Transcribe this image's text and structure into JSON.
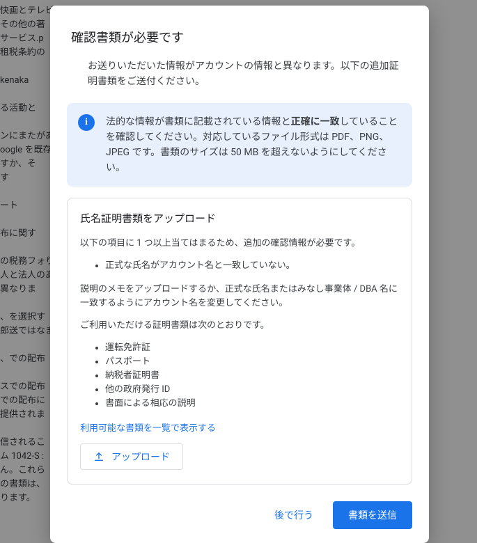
{
  "background_lines": [
    "快画とテレビ番組 pdf",
    "その他の著",
    "サービス.p",
    "租税条約の",
    "",
    "kenaka",
    "",
    "る活動と",
    "",
    "ンにまたがあります",
    "oogle を既存のお支",
    "すか、そ",
    "す",
    "",
    "ート",
    "",
    "布に関す",
    "",
    "の税務フォります。こ",
    "人と法人のあるかどう",
    "異なりま",
    "",
    "、を選択す",
    "郎送ではなます。",
    "",
    "、での配布",
    "",
    "スでの配布",
    "での配布に",
    "提供されま",
    "",
    "信されるこ",
    "ム 1042-S :",
    "ん。これら",
    "の書類は、",
    "ります。"
  ],
  "modal": {
    "title": "確認書類が必要です",
    "description": "お送りいただいた情報がアカウントの情報と異なります。以下の追加証明書類をご送付ください。",
    "info_prefix": "法的な情報が書類に記載されている情報と",
    "info_bold": "正確に一致",
    "info_suffix": "していることを確認してください。対応しているファイル形式は PDF、PNG、JPEG です。書類のサイズは 50 MB を超えないようにしてください。"
  },
  "card": {
    "title": "氏名証明書類をアップロード",
    "p1": "以下の項目に 1 つ以上当てはまるため、追加の確認情報が必要です。",
    "reasons": [
      "正式な氏名がアカウント名と一致していない。"
    ],
    "p2": "説明のメモをアップロードするか、正式な氏名またはみなし事業体 / DBA 名に一致するようにアカウント名を変更してください。",
    "p3": "ご利用いただける証明書類は次のとおりです。",
    "docs": [
      "運転免許証",
      "パスポート",
      "納税者証明書",
      "他の政府発行 ID",
      "書面による相応の説明"
    ],
    "link": "利用可能な書類を一覧で表示する",
    "upload": "アップロード"
  },
  "footer": {
    "later": "後で行う",
    "submit": "書類を送信"
  }
}
